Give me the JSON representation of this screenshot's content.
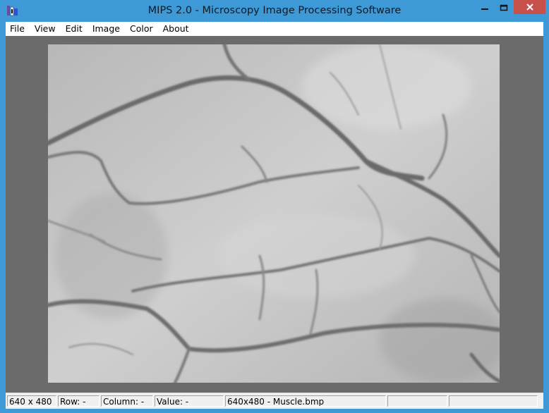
{
  "window": {
    "title": "MIPS 2.0 - Microscopy Image Processing Software",
    "icon": "mips-app-icon",
    "controls": [
      "minimize-icon",
      "maximize-icon",
      "close-icon"
    ],
    "titlebar_color": "#3d9ad6",
    "close_color": "#c7504a"
  },
  "menu": {
    "items": [
      {
        "label": "File"
      },
      {
        "label": "View"
      },
      {
        "label": "Edit"
      },
      {
        "label": "Image"
      },
      {
        "label": "Color"
      },
      {
        "label": "About"
      }
    ]
  },
  "canvas": {
    "description_image": "grayscale microscopy image of muscle tissue with branching blood vessels",
    "background_color": "#6b6b6b"
  },
  "status": {
    "dimensions": "640 x 480",
    "row": "Row: -",
    "column": "Column: -",
    "value": "Value: -",
    "file": "640x480 - Muscle.bmp",
    "extra1": "",
    "extra2": ""
  }
}
